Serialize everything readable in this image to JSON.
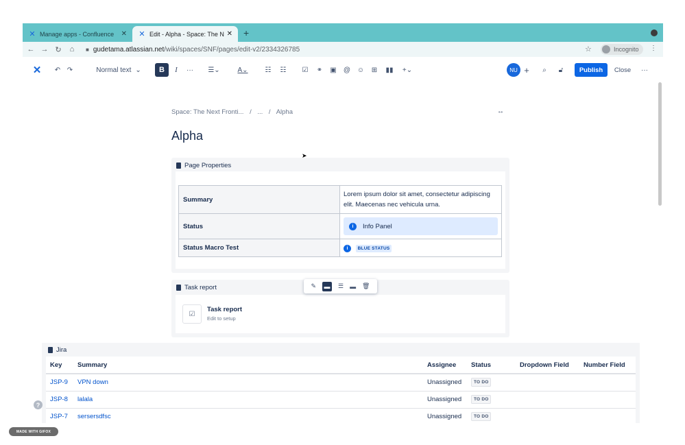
{
  "browser": {
    "tabs": [
      {
        "title": "Manage apps - Confluence",
        "icon": "confluence-icon",
        "active": false
      },
      {
        "title": "Edit - Alpha - Space: The Next",
        "icon": "confluence-icon",
        "active": true
      }
    ],
    "url_host": "gudetama.atlassian.net",
    "url_path": "/wiki/spaces/SNF/pages/edit-v2/2334326785",
    "profile_label": "Incognito"
  },
  "toolbar": {
    "text_style": "Normal text",
    "bold_label": "B",
    "italic_label": "I",
    "more_label": "···",
    "avatar_initials": "NU",
    "publish_label": "Publish",
    "close_label": "Close",
    "overflow_label": "···"
  },
  "page": {
    "breadcrumb": [
      "Space: The Next Fronti...",
      "...",
      "Alpha"
    ],
    "title": "Alpha"
  },
  "page_properties": {
    "heading": "Page Properties",
    "rows": [
      {
        "key": "Summary",
        "value": "Lorem ipsum dolor sit amet, consectetur adipiscing elit. Maecenas nec vehicula urna."
      },
      {
        "key": "Status",
        "value": "Info Panel"
      },
      {
        "key": "Status Macro Test",
        "value": "BLUE STATUS"
      }
    ]
  },
  "task_report": {
    "heading": "Task report",
    "title": "Task report",
    "subtitle": "Edit to setup"
  },
  "jira": {
    "heading": "Jira",
    "columns": [
      "Key",
      "Summary",
      "Assignee",
      "Status",
      "Dropdown Field",
      "Number Field"
    ],
    "rows": [
      {
        "key": "JSP-9",
        "summary": "VPN down",
        "assignee": "Unassigned",
        "status": "TO DO"
      },
      {
        "key": "JSP-8",
        "summary": "lalala",
        "assignee": "Unassigned",
        "status": "TO DO"
      },
      {
        "key": "JSP-7",
        "summary": "sersersdfsc",
        "assignee": "Unassigned",
        "status": "TO DO"
      }
    ]
  },
  "watermark": "MADE WITH GIFOX",
  "colors": {
    "tabstrip": "#63c3c8",
    "accent": "#0c66e4",
    "info_panel": "#deebff",
    "macro_bg": "#f4f5f7"
  }
}
